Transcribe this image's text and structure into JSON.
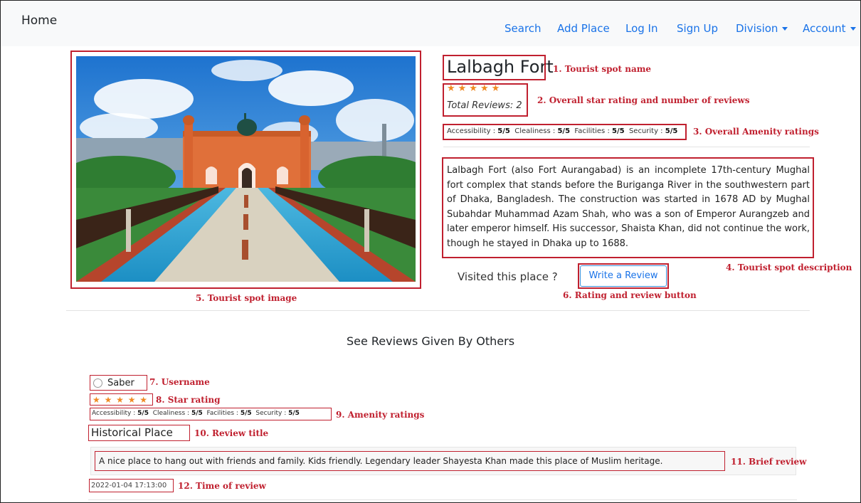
{
  "navbar": {
    "brand": "Home",
    "links": {
      "search": "Search",
      "add_place": "Add Place",
      "log_in": "Log In",
      "sign_up": "Sign Up",
      "division": "Division",
      "account": "Account"
    },
    "link_color": "#1a73e8"
  },
  "spot": {
    "name": "Lalbagh Fort",
    "stars": "★★★★★",
    "star_rating": 5,
    "total_reviews": "Total Reviews: 2",
    "amenities": {
      "accessibility_label": "Accessibility :",
      "accessibility_value": "5/5",
      "cleanliness_label": "Clealiness :",
      "cleanliness_value": "5/5",
      "facilities_label": "Facilities :",
      "facilities_value": "5/5",
      "security_label": "Security :",
      "security_value": "5/5"
    },
    "description": "Lalbagh Fort (also Fort Aurangabad) is an incomplete 17th-century Mughal fort complex that stands before the Buriganga River in the southwestern part of Dhaka, Bangladesh. The construction was started in 1678 AD by Mughal Subahdar Muhammad Azam Shah, who was a son of Emperor Aurangzeb and later emperor himself. His successor, Shaista Khan, did not continue the work, though he stayed in Dhaka up to 1688.",
    "visited_prompt": "Visited this place ?",
    "write_review_label": "Write a Review"
  },
  "reviews_section": {
    "heading": "See Reviews Given By Others",
    "reviews": [
      {
        "username": "Saber",
        "stars": "★ ★ ★ ★ ★",
        "star_rating": 5,
        "amenities": {
          "accessibility_label": "Accessibility :",
          "accessibility_value": "5/5",
          "cleanliness_label": "Clealiness :",
          "cleanliness_value": "5/5",
          "facilities_label": "Facilities :",
          "facilities_value": "5/5",
          "security_label": "Security :",
          "security_value": "5/5"
        },
        "title": "Historical Place",
        "body": "A nice place to hang out with friends and family. Kids friendly. Legendary leader Shayesta Khan made this place of Muslim heritage.",
        "time": "2022-01-04 17:13:00"
      }
    ]
  },
  "annotations": {
    "a1": "1. Tourist spot name",
    "a2": "2. Overall star rating and number of reviews",
    "a3": "3. Overall Amenity ratings",
    "a4": "4. Tourist spot description",
    "a5": "5. Tourist spot image",
    "a6": "6. Rating and review button",
    "a7": "7. Username",
    "a8": "8. Star rating",
    "a9": "9. Amenity ratings",
    "a10": "10. Review title",
    "a11": "11. Brief review",
    "a12": "12. Time of review",
    "color": "#c0202f"
  },
  "colors": {
    "star": "#f08a24",
    "navbar_bg": "#f8f9fa",
    "button_border": "#3b8fd9"
  }
}
